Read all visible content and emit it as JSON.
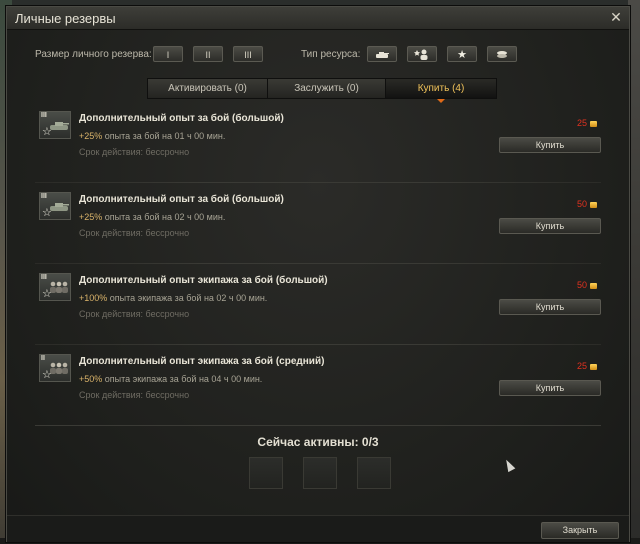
{
  "window": {
    "title": "Личные резервы"
  },
  "filters": {
    "size_label": "Размер личного резерва:",
    "size_buttons": [
      "I",
      "II",
      "III"
    ],
    "resource_label": "Тип ресурса:",
    "resource_icons": [
      "tank-icon",
      "crew-icon",
      "star-icon",
      "coins-icon"
    ]
  },
  "tabs": [
    {
      "label": "Активировать (0)",
      "active": false
    },
    {
      "label": "Заслужить (0)",
      "active": false
    },
    {
      "label": "Купить (4)",
      "active": true
    }
  ],
  "items": [
    {
      "level": "III",
      "icon": "tank-icon",
      "title": "Дополнительный опыт за бой (большой)",
      "bonus": "+25%",
      "desc": " опыта за бой на 01 ч 00 мин.",
      "expiry": "Срок действия: бессрочно",
      "price": "25",
      "buy_label": "Купить"
    },
    {
      "level": "III",
      "icon": "tank-icon",
      "title": "Дополнительный опыт за бой (большой)",
      "bonus": "+25%",
      "desc": " опыта за бой на 02 ч 00 мин.",
      "expiry": "Срок действия: бессрочно",
      "price": "50",
      "buy_label": "Купить"
    },
    {
      "level": "III",
      "icon": "crew-icon",
      "title": "Дополнительный опыт экипажа за бой (большой)",
      "bonus": "+100%",
      "desc": " опыта экипажа за бой на 02 ч 00 мин.",
      "expiry": "Срок действия: бессрочно",
      "price": "50",
      "buy_label": "Купить"
    },
    {
      "level": "II",
      "icon": "crew-icon",
      "title": "Дополнительный опыт экипажа за бой (средний)",
      "bonus": "+50%",
      "desc": " опыта экипажа за бой на 04 ч 00 мин.",
      "expiry": "Срок действия: бессрочно",
      "price": "25",
      "buy_label": "Купить"
    }
  ],
  "active": {
    "title": "Сейчас активны: 0/3",
    "slots": 3
  },
  "footer": {
    "close_label": "Закрыть"
  },
  "colors": {
    "price": "#e0311f",
    "bonus": "#d9b36a",
    "active_tab": "#f0c25a",
    "accent": "#e06a18"
  }
}
